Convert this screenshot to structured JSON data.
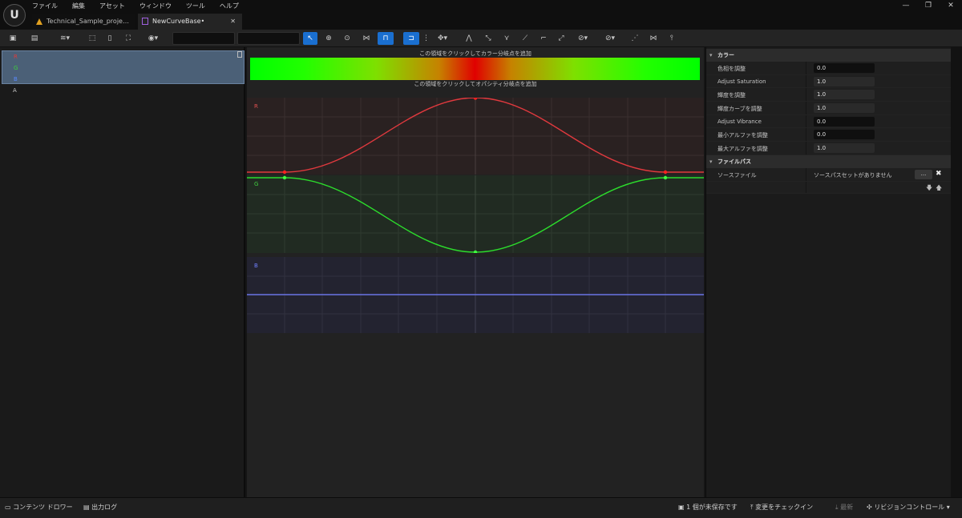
{
  "menu": [
    "ファイル",
    "編集",
    "アセット",
    "ウィンドウ",
    "ツール",
    "ヘルプ"
  ],
  "tabs": [
    {
      "label": "Technical_Sample_proje…",
      "active": false
    },
    {
      "label": "NewCurveBase•",
      "active": true
    }
  ],
  "channels": [
    "R",
    "G",
    "B",
    "A"
  ],
  "center": {
    "color_hint": "この領域をクリックしてカラー分岐点を追加",
    "opacity_hint": "この領域をクリックしてオパシティ分岐点を追加",
    "graph_labels": [
      "R",
      "G",
      "B"
    ]
  },
  "details": {
    "color_section": "カラー",
    "properties": [
      {
        "label": "色相を調整",
        "value": "0.0"
      },
      {
        "label": "Adjust Saturation",
        "value": "1.0"
      },
      {
        "label": "輝度を調整",
        "value": "1.0"
      },
      {
        "label": "輝度カーブを調整",
        "value": "1.0"
      },
      {
        "label": "Adjust Vibrance",
        "value": "0.0"
      },
      {
        "label": "最小アルファを調整",
        "value": "0.0"
      },
      {
        "label": "最大アルファを調整",
        "value": "1.0"
      }
    ],
    "filepath_section": "ファイルパス",
    "source_label": "ソースファイル",
    "source_value": "ソースパスセットがありません",
    "browse_label": "..."
  },
  "status": {
    "content_drawer": "コンテンツ ドロワー",
    "output_log": "出力ログ",
    "unsaved": "1 個が未保存です",
    "check_in": "変更をチェックイン",
    "latest": "最新",
    "revision_control": "リビジョンコントロール"
  },
  "colors": {
    "accent": "#1a6fd0",
    "red_curve": "#e0393e",
    "green_curve": "#2cdc2c",
    "blue_curve": "#6a74e6"
  }
}
